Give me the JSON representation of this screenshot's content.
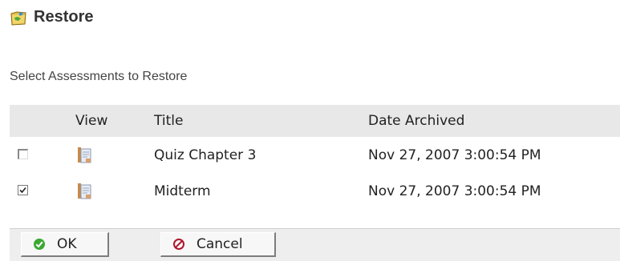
{
  "page": {
    "title": "Restore",
    "header_icon": "restore-folder-icon"
  },
  "instruction": "Select Assessments to Restore",
  "table": {
    "columns": [
      "View",
      "Title",
      "Date Archived"
    ],
    "rows": [
      {
        "selected": false,
        "title": "Quiz Chapter 3",
        "date_archived": "Nov 27, 2007 3:00:54 PM"
      },
      {
        "selected": true,
        "title": "Midterm",
        "date_archived": "Nov 27, 2007 3:00:54 PM"
      }
    ]
  },
  "buttons": {
    "ok_label": "OK",
    "cancel_label": "Cancel"
  },
  "colors": {
    "ok_icon": "#3aa832",
    "cancel_icon": "#b0142a",
    "header_bg": "#e8e8e8"
  }
}
